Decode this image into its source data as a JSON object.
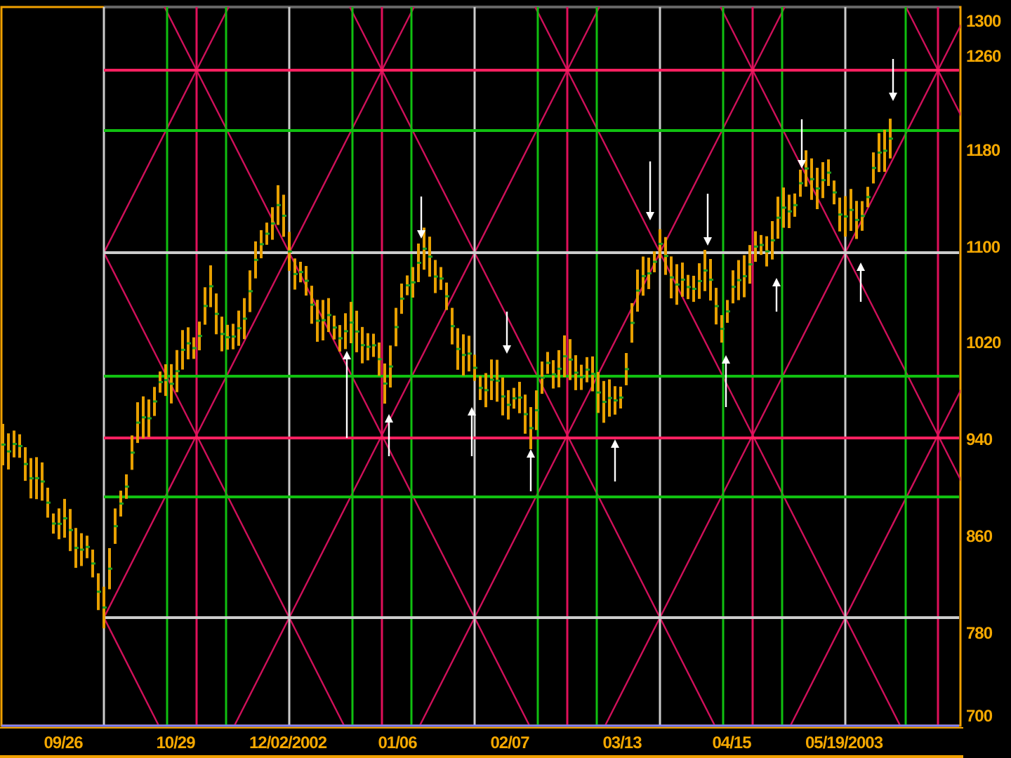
{
  "chart": {
    "y_axis_labels": [
      "1300",
      "1260",
      "1180",
      "1100",
      "1020",
      "940",
      "860",
      "780",
      "700"
    ],
    "x_axis_labels": [
      "09/26",
      "10/29",
      "12/02/2002",
      "01/06",
      "02/07",
      "03/13",
      "04/15",
      "05/19/2003"
    ]
  }
}
